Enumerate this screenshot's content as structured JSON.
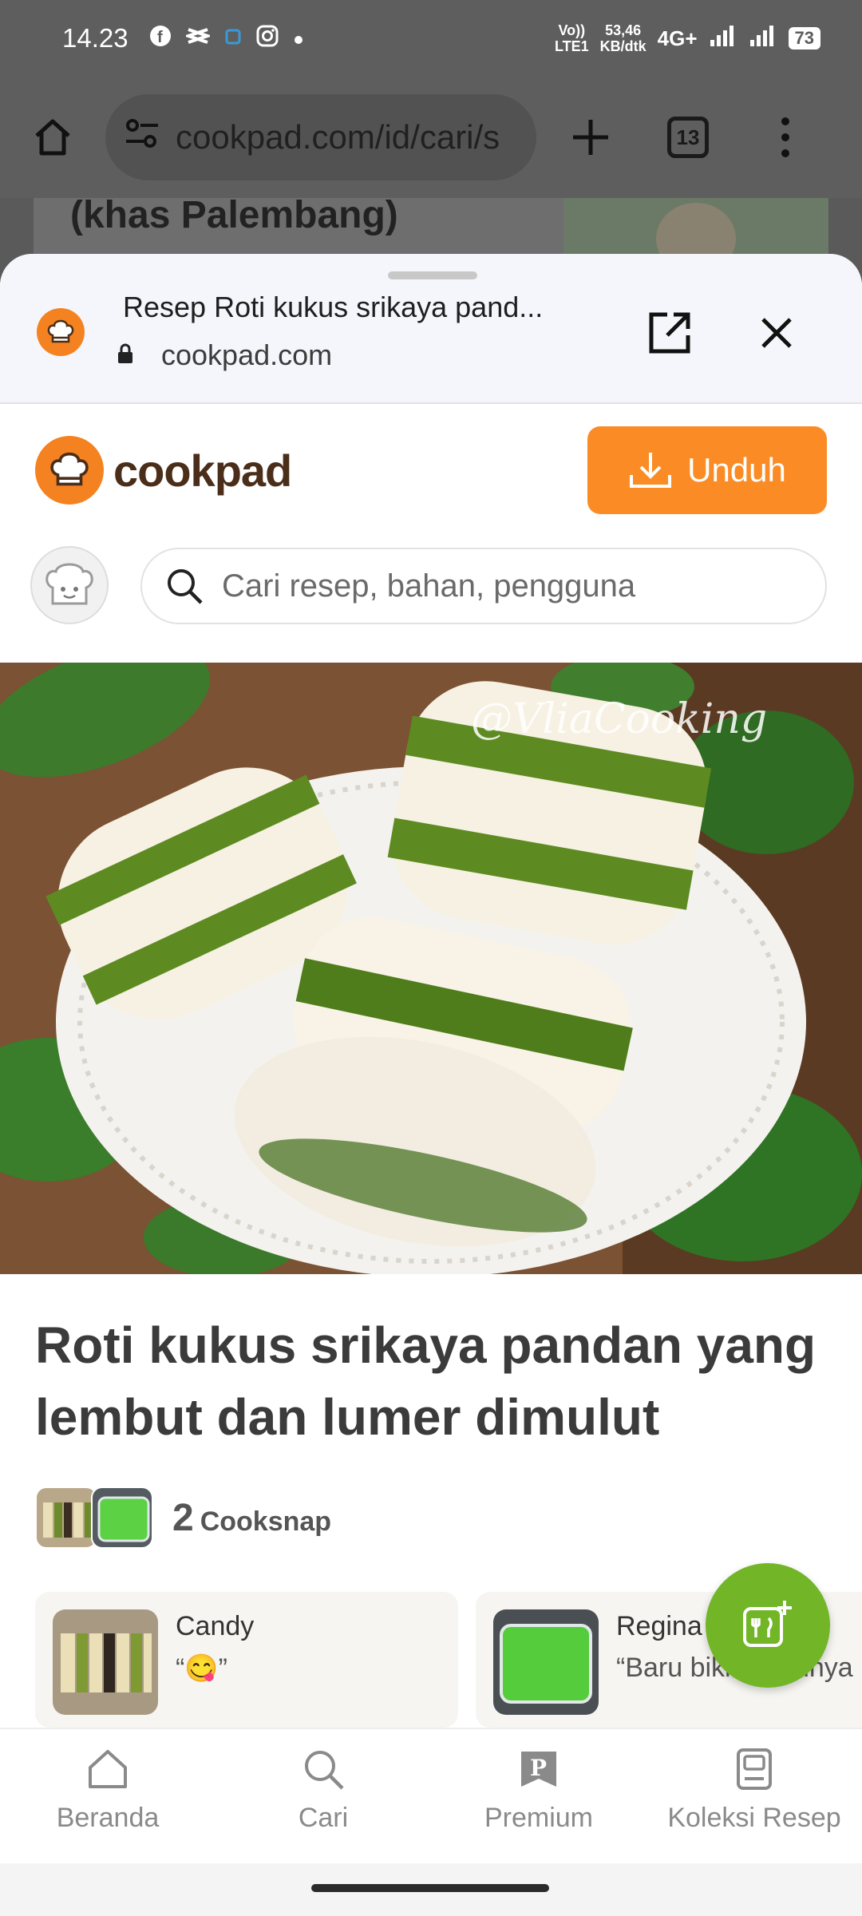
{
  "status_bar": {
    "time": "14.23",
    "net_type_top": "Vo))",
    "net_type_bottom": "LTE1",
    "speed_top": "53,46",
    "speed_bottom": "KB/dtk",
    "network": "4G+",
    "battery": "73"
  },
  "browser": {
    "url": "cookpad.com/id/cari/s",
    "tab_count": "13"
  },
  "behind_page": {
    "title": "(khas Palembang)"
  },
  "custom_tab": {
    "title": "Resep Roti kukus srikaya pand...",
    "domain": "cookpad.com"
  },
  "cookpad": {
    "logo_text": "cookpad",
    "download_label": "Unduh",
    "search_placeholder": "Cari resep, bahan, pengguna",
    "watermark": "@VliaCooking",
    "recipe_title": "Roti kukus srikaya pandan yang lembut dan lumer dimulut",
    "cooksnap_count": "2",
    "cooksnap_label": "Cooksnap",
    "snaps": [
      {
        "name": "Candy",
        "quote": "“😋”"
      },
      {
        "name": "Regina",
        "quote": "“Baru bikin hasilnya"
      }
    ]
  },
  "bottom_nav": [
    {
      "label": "Beranda",
      "icon": "home-icon"
    },
    {
      "label": "Cari",
      "icon": "search-icon"
    },
    {
      "label": "Premium",
      "icon": "premium-icon"
    },
    {
      "label": "Koleksi Resep",
      "icon": "book-icon"
    }
  ],
  "colors": {
    "accent": "#fb8c25",
    "fab": "#72b628",
    "pandan_green": "#5e8a22"
  }
}
